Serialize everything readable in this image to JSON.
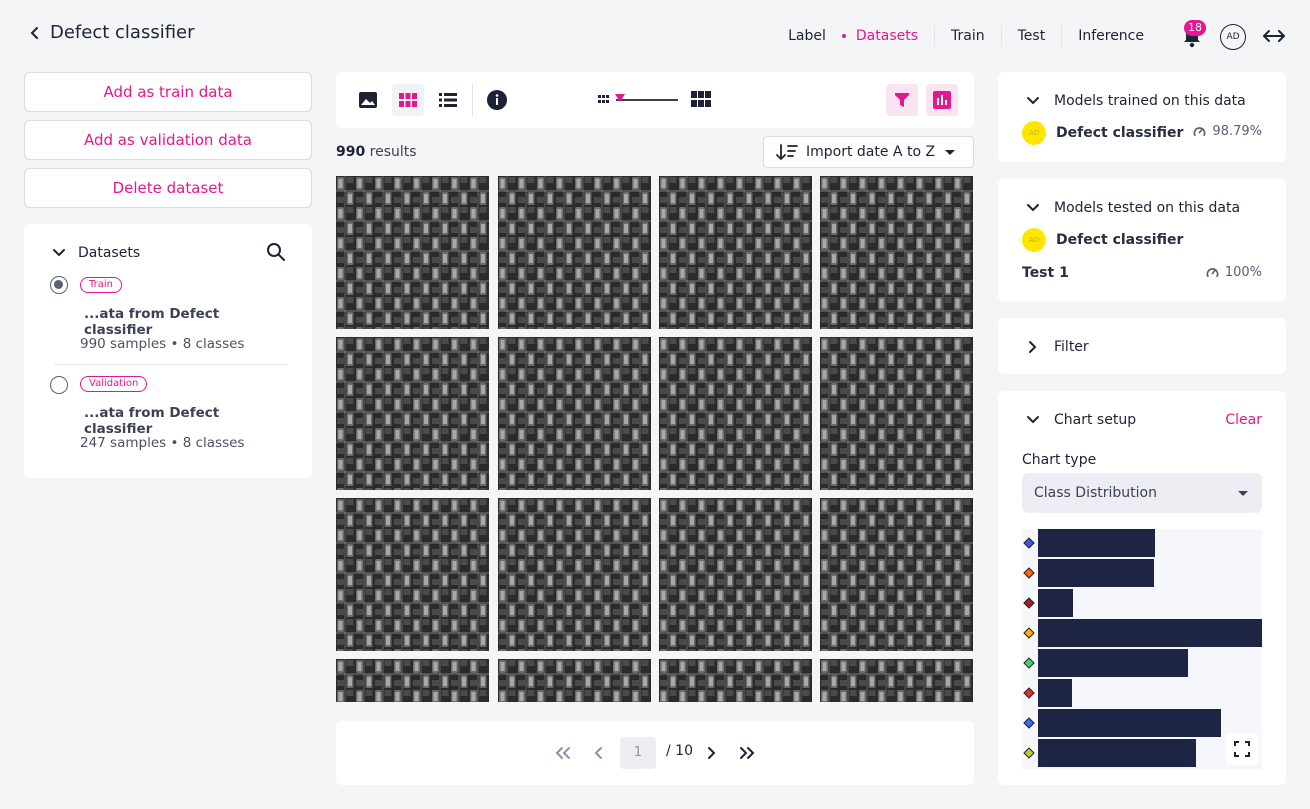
{
  "header": {
    "title": "Defect classifier",
    "nav": [
      {
        "label": "Label",
        "active": false
      },
      {
        "label": "Datasets",
        "active": true
      },
      {
        "label": "Train",
        "active": false
      },
      {
        "label": "Test",
        "active": false
      },
      {
        "label": "Inference",
        "active": false
      }
    ],
    "notification_count": "18",
    "avatar_initials": "AD",
    "accent_color": "#e0198f"
  },
  "left": {
    "actions": {
      "add_train": "Add as train data",
      "add_validation": "Add as validation data",
      "delete": "Delete dataset"
    },
    "datasets_title": "Datasets",
    "datasets": [
      {
        "tag": "Train",
        "name": "...ata from Defect classifier",
        "meta": "990 samples • 8 classes",
        "selected": true
      },
      {
        "tag": "Validation",
        "name": "...ata from Defect classifier",
        "meta": "247 samples • 8 classes",
        "selected": false
      }
    ]
  },
  "center": {
    "results_count": "990",
    "results_label": " results",
    "sort_label": "Import date A to Z",
    "pager": {
      "current_page": "1",
      "total_label": "/ 10"
    }
  },
  "right": {
    "trained": {
      "title": "Models trained on this data",
      "model_name": "Defect classifier",
      "model_initials": "AD",
      "accuracy": "98.79%"
    },
    "tested": {
      "title": "Models tested on this data",
      "model_name": "Defect classifier",
      "model_initials": "AD",
      "test_name": "Test 1",
      "accuracy": "100%"
    },
    "filter_title": "Filter",
    "chart_setup": {
      "title": "Chart setup",
      "clear_label": "Clear",
      "chart_type_label": "Chart type",
      "chart_type_value": "Class Distribution"
    }
  },
  "chart_data": {
    "type": "bar",
    "orientation": "horizontal",
    "values": [
      117,
      116,
      35,
      224,
      150,
      34,
      183,
      158
    ],
    "class_colors": [
      "#3b5bdb",
      "#f76707",
      "#a61e1e",
      "#fab005",
      "#51cf66",
      "#e03131",
      "#4263eb",
      "#c0ca33"
    ],
    "bar_color": "#1e2544"
  }
}
